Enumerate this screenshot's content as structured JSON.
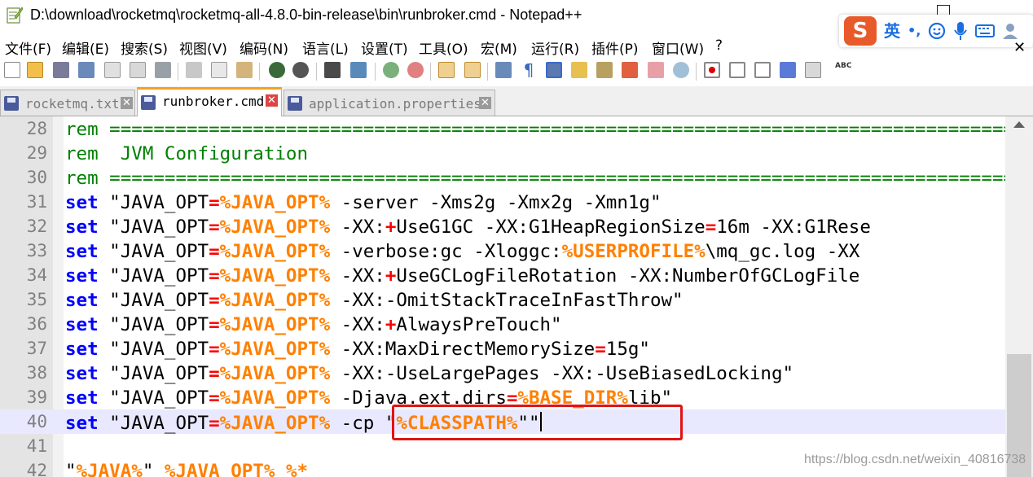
{
  "window": {
    "title": "D:\\download\\rocketmq\\rocketmq-all-4.8.0-bin-release\\bin\\runbroker.cmd - Notepad++",
    "menu_close_glyph": "✕"
  },
  "ime": {
    "logo": "S",
    "lang_label": "英",
    "punct_label": "•,",
    "icons": [
      "smiley-icon",
      "microphone-icon",
      "keyboard-icon",
      "user-icon"
    ]
  },
  "menu": [
    "文件(F)",
    "编辑(E)",
    "搜索(S)",
    "视图(V)",
    "编码(N)",
    "语言(L)",
    "设置(T)",
    "工具(O)",
    "宏(M)",
    "运行(R)",
    "插件(P)",
    "窗口(W)",
    "?"
  ],
  "tabs": [
    {
      "label": "rocketmq.txt",
      "active": false
    },
    {
      "label": "runbroker.cmd",
      "active": true
    },
    {
      "label": "application.properties",
      "active": false
    }
  ],
  "tab_close_glyph": "✕",
  "editor": {
    "lines": [
      {
        "num": "28",
        "segments": [
          {
            "t": "rem =================================================================================================",
            "c": "c"
          }
        ]
      },
      {
        "num": "29",
        "segments": [
          {
            "t": "rem  JVM Configuration",
            "c": "c"
          }
        ]
      },
      {
        "num": "30",
        "segments": [
          {
            "t": "rem =================================================================================================",
            "c": "c"
          }
        ]
      },
      {
        "num": "31",
        "segments": [
          {
            "t": "set",
            "c": "k"
          },
          {
            "t": " \"JAVA_OPT",
            "c": "s"
          },
          {
            "t": "=",
            "c": "o"
          },
          {
            "t": "%JAVA_OPT%",
            "c": "v"
          },
          {
            "t": " -server -Xms2g -Xmx2g -Xmn1g\"",
            "c": "s"
          }
        ]
      },
      {
        "num": "32",
        "segments": [
          {
            "t": "set",
            "c": "k"
          },
          {
            "t": " \"JAVA_OPT",
            "c": "s"
          },
          {
            "t": "=",
            "c": "o"
          },
          {
            "t": "%JAVA_OPT%",
            "c": "v"
          },
          {
            "t": " -XX:",
            "c": "s"
          },
          {
            "t": "+",
            "c": "o"
          },
          {
            "t": "UseG1GC -XX:G1HeapRegionSize",
            "c": "s"
          },
          {
            "t": "=",
            "c": "o"
          },
          {
            "t": "16m -XX:G1Rese",
            "c": "s"
          }
        ]
      },
      {
        "num": "33",
        "segments": [
          {
            "t": "set",
            "c": "k"
          },
          {
            "t": " \"JAVA_OPT",
            "c": "s"
          },
          {
            "t": "=",
            "c": "o"
          },
          {
            "t": "%JAVA_OPT%",
            "c": "v"
          },
          {
            "t": " -verbose:gc -Xloggc:",
            "c": "s"
          },
          {
            "t": "%USERPROFILE%",
            "c": "v"
          },
          {
            "t": "\\mq_gc.log -XX",
            "c": "s"
          }
        ]
      },
      {
        "num": "34",
        "segments": [
          {
            "t": "set",
            "c": "k"
          },
          {
            "t": " \"JAVA_OPT",
            "c": "s"
          },
          {
            "t": "=",
            "c": "o"
          },
          {
            "t": "%JAVA_OPT%",
            "c": "v"
          },
          {
            "t": " -XX:",
            "c": "s"
          },
          {
            "t": "+",
            "c": "o"
          },
          {
            "t": "UseGCLogFileRotation -XX:NumberOfGCLogFile",
            "c": "s"
          }
        ]
      },
      {
        "num": "35",
        "segments": [
          {
            "t": "set",
            "c": "k"
          },
          {
            "t": " \"JAVA_OPT",
            "c": "s"
          },
          {
            "t": "=",
            "c": "o"
          },
          {
            "t": "%JAVA_OPT%",
            "c": "v"
          },
          {
            "t": " -XX:-OmitStackTraceInFastThrow\"",
            "c": "s"
          }
        ]
      },
      {
        "num": "36",
        "segments": [
          {
            "t": "set",
            "c": "k"
          },
          {
            "t": " \"JAVA_OPT",
            "c": "s"
          },
          {
            "t": "=",
            "c": "o"
          },
          {
            "t": "%JAVA_OPT%",
            "c": "v"
          },
          {
            "t": " -XX:",
            "c": "s"
          },
          {
            "t": "+",
            "c": "o"
          },
          {
            "t": "AlwaysPreTouch\"",
            "c": "s"
          }
        ]
      },
      {
        "num": "37",
        "segments": [
          {
            "t": "set",
            "c": "k"
          },
          {
            "t": " \"JAVA_OPT",
            "c": "s"
          },
          {
            "t": "=",
            "c": "o"
          },
          {
            "t": "%JAVA_OPT%",
            "c": "v"
          },
          {
            "t": " -XX:MaxDirectMemorySize",
            "c": "s"
          },
          {
            "t": "=",
            "c": "o"
          },
          {
            "t": "15g\"",
            "c": "s"
          }
        ]
      },
      {
        "num": "38",
        "segments": [
          {
            "t": "set",
            "c": "k"
          },
          {
            "t": " \"JAVA_OPT",
            "c": "s"
          },
          {
            "t": "=",
            "c": "o"
          },
          {
            "t": "%JAVA_OPT%",
            "c": "v"
          },
          {
            "t": " -XX:-UseLargePages -XX:-UseBiasedLocking\"",
            "c": "s"
          }
        ]
      },
      {
        "num": "39",
        "segments": [
          {
            "t": "set",
            "c": "k"
          },
          {
            "t": " \"JAVA_OPT",
            "c": "s"
          },
          {
            "t": "=",
            "c": "o"
          },
          {
            "t": "%JAVA_OPT%",
            "c": "v"
          },
          {
            "t": " -Djava.ext.dirs",
            "c": "s"
          },
          {
            "t": "=",
            "c": "o"
          },
          {
            "t": "%BASE_DIR%",
            "c": "v"
          },
          {
            "t": "lib\"",
            "c": "s"
          }
        ]
      },
      {
        "num": "40",
        "current": true,
        "segments": [
          {
            "t": "set",
            "c": "k"
          },
          {
            "t": " \"JAVA_OPT",
            "c": "s"
          },
          {
            "t": "=",
            "c": "o"
          },
          {
            "t": "%JAVA_OPT%",
            "c": "v"
          },
          {
            "t": " -cp \"",
            "c": "s"
          },
          {
            "t": "%CLASSPATH%",
            "c": "v"
          },
          {
            "t": "\"\"",
            "c": "s"
          }
        ]
      },
      {
        "num": "41",
        "segments": []
      },
      {
        "num": "42",
        "segments": [
          {
            "t": "\"",
            "c": "s"
          },
          {
            "t": "%JAVA%",
            "c": "v"
          },
          {
            "t": "\" ",
            "c": "s"
          },
          {
            "t": "%JAVA_OPT%",
            "c": "v"
          },
          {
            "t": " ",
            "c": "s"
          },
          {
            "t": "%*",
            "c": "v"
          }
        ]
      }
    ]
  },
  "watermark": "https://blog.csdn.net/weixin_40816738"
}
